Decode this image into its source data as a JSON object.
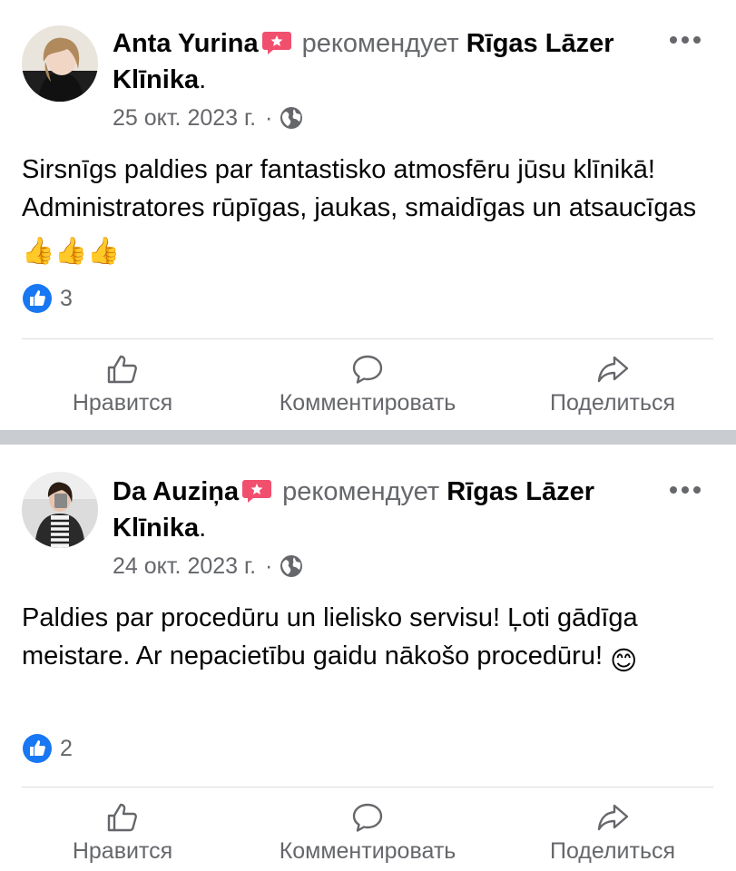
{
  "posts": [
    {
      "author": "Anta Yurina",
      "verb": "рекомендует",
      "page": "Rīgas Lāzer Klīnika",
      "period": ".",
      "date": "25 окт. 2023 г.",
      "separator": "·",
      "privacy_icon": "globe-icon",
      "body": "Sirsnīgs paldies par fantastisko atmosfēru jūsu klīnikā! Administratores rūpīgas, jaukas, smaidīgas un atsaucīgas",
      "body_emoji": "👍👍👍",
      "reaction_icon": "like-icon",
      "reaction_count": "3",
      "actions": {
        "like": "Нравится",
        "comment": "Комментировать",
        "share": "Поделиться"
      }
    },
    {
      "author": "Da Auziņa",
      "verb": "рекомендует",
      "page": "Rīgas Lāzer Klīnika",
      "period": ".",
      "date": "24 окт. 2023 г.",
      "separator": "·",
      "privacy_icon": "globe-icon",
      "body": "Paldies par procedūru un lielisko servisu! Ļoti gādīga meistare. Ar nepacietību gaidu nākošo procedūru!",
      "body_emoji": "😊",
      "reaction_icon": "like-icon",
      "reaction_count": "2",
      "actions": {
        "like": "Нравится",
        "comment": "Комментировать",
        "share": "Поделиться"
      }
    }
  ],
  "colors": {
    "text_primary": "#050505",
    "text_secondary": "#65676b",
    "like_blue": "#1877f2",
    "recommend_red": "#f0506e",
    "divider_band": "#c9ccd1",
    "separator": "#dadde1"
  }
}
